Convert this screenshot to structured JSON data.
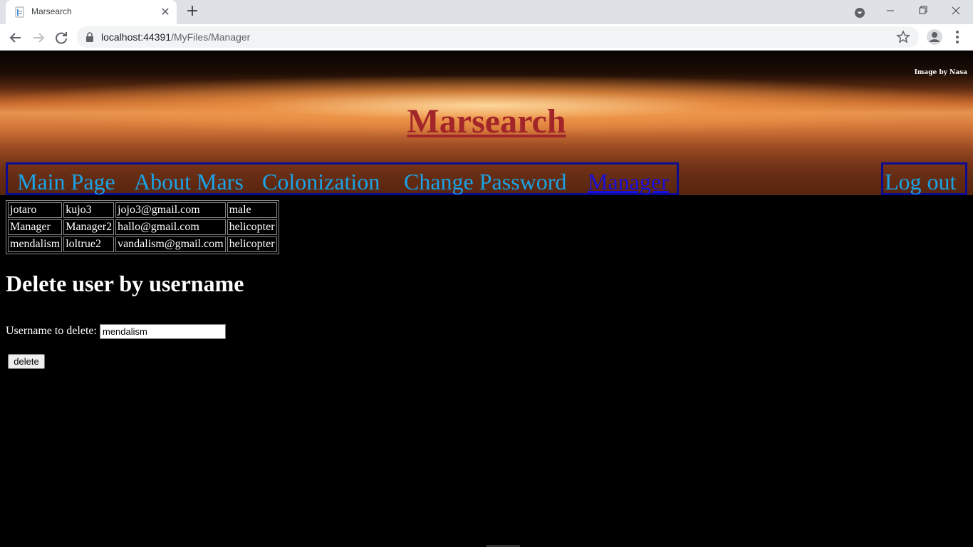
{
  "browser": {
    "tab_title": "Marsearch",
    "url_host": "localhost:44391",
    "url_path": "/MyFiles/Manager"
  },
  "header": {
    "image_credit": "Image by Nasa",
    "site_title": "Marsearch"
  },
  "nav": {
    "items": [
      {
        "label": "Main Page"
      },
      {
        "label": "About Mars"
      },
      {
        "label": "Colonization"
      },
      {
        "label": "Change Password"
      },
      {
        "label": "Manager",
        "active": true
      }
    ],
    "logout": "Log out"
  },
  "users_table": {
    "rows": [
      [
        "jotaro",
        "kujo3",
        "jojo3@gmail.com",
        "male"
      ],
      [
        "Manager",
        "Manager2",
        "hallo@gmail.com",
        "helicopter"
      ],
      [
        "mendalism",
        "loltrue2",
        "vandalism@gmail.com",
        "helicopter"
      ]
    ]
  },
  "delete_form": {
    "heading": "Delete user by username",
    "label": "Username to delete:",
    "input_value": "mendalism",
    "button": "delete"
  },
  "colors": {
    "nav_link": "#1aa3e6",
    "nav_active": "#1a0edb",
    "nav_border": "#0c0c93",
    "title": "#a2252a",
    "page_bg": "#000000"
  }
}
